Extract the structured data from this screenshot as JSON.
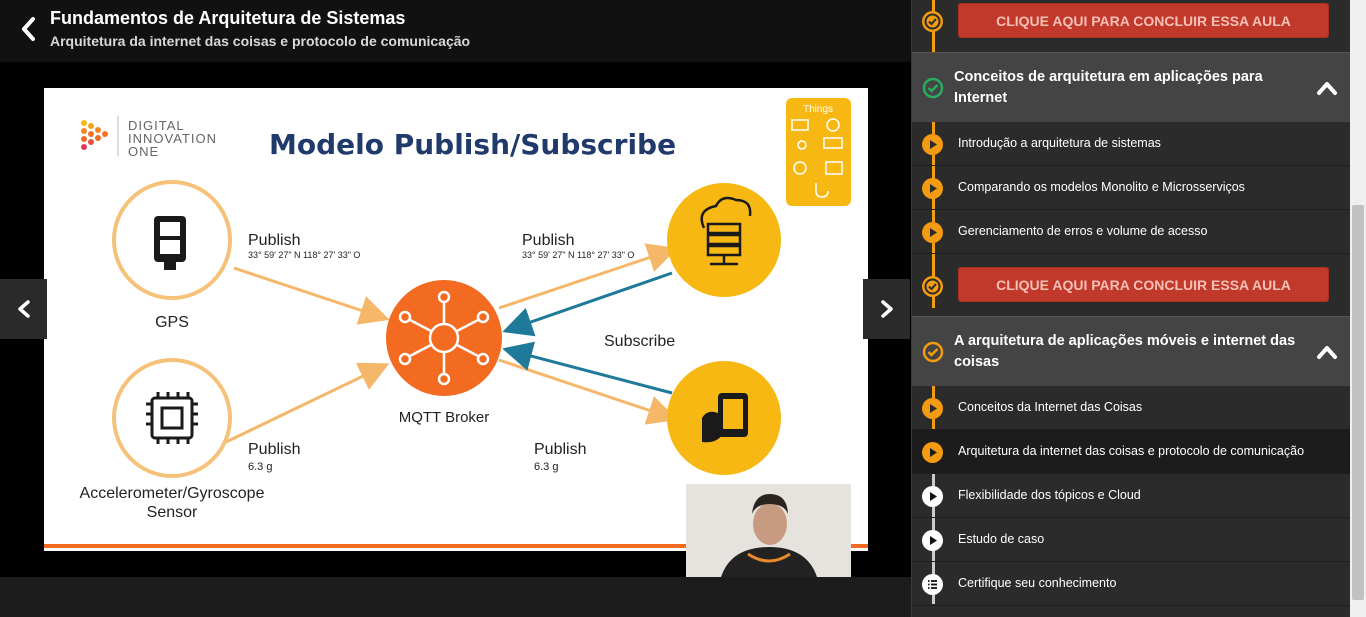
{
  "header": {
    "course_title": "Fundamentos de Arquitetura de Sistemas",
    "lesson_subtitle": "Arquitetura da internet das coisas e protocolo de comunicação"
  },
  "slide": {
    "logo_line1": "DIGITAL",
    "logo_line2": "INNOVATION",
    "logo_line3": "ONE",
    "title": "Modelo Publish/Subscribe",
    "things_label": "Things",
    "gps_label": "GPS",
    "sensor_label_line1": "Accelerometer/Gyroscope",
    "sensor_label_line2": "Sensor",
    "broker_label": "MQTT Broker",
    "publish1": "Publish",
    "coords1": "33° 59' 27\" N 118° 27' 33\" O",
    "publish2": "Publish",
    "coords2": "33° 59' 27\" N 118° 27' 33\" O",
    "subscribe": "Subscribe",
    "publish3": "Publish",
    "value3": "6.3 g",
    "publish4": "Publish",
    "value4": "6.3 g",
    "colors": {
      "orange": "#f26b21",
      "yellow": "#f8b814",
      "navy": "#1f3a6b",
      "teal": "#1f7a99",
      "arrow_orange": "#f5b76a"
    }
  },
  "sidebar": {
    "conclude_label": "CLIQUE AQUI PARA CONCLUIR ESSA AULA",
    "sections": [
      {
        "title": "Conceitos de arquitetura em aplicações para Internet",
        "status_icon": "check-circle-green-icon",
        "items": [
          {
            "label": "Introdução a arquitetura de sistemas",
            "icon": "play-icon"
          },
          {
            "label": "Comparando os modelos Monolito e Microsserviços",
            "icon": "play-icon"
          },
          {
            "label": "Gerenciamento de erros e volume de acesso",
            "icon": "play-icon"
          }
        ],
        "conclude_label": "CLIQUE AQUI PARA CONCLUIR ESSA AULA"
      },
      {
        "title": "A arquitetura de aplicações móveis e internet das coisas",
        "status_icon": "check-circle-orange-icon",
        "items": [
          {
            "label": "Conceitos da Internet das Coisas",
            "icon": "play-icon"
          },
          {
            "label": "Arquitetura da internet das coisas e protocolo de comunicação",
            "icon": "play-icon",
            "active": true
          },
          {
            "label": "Flexibilidade dos tópicos e Cloud",
            "icon": "play-icon"
          },
          {
            "label": "Estudo de caso",
            "icon": "play-icon"
          },
          {
            "label": "Certifique seu conhecimento",
            "icon": "list-icon"
          }
        ]
      }
    ],
    "colors": {
      "accent": "#f39c12",
      "button": "#c0392b",
      "green": "#27ae60"
    }
  }
}
